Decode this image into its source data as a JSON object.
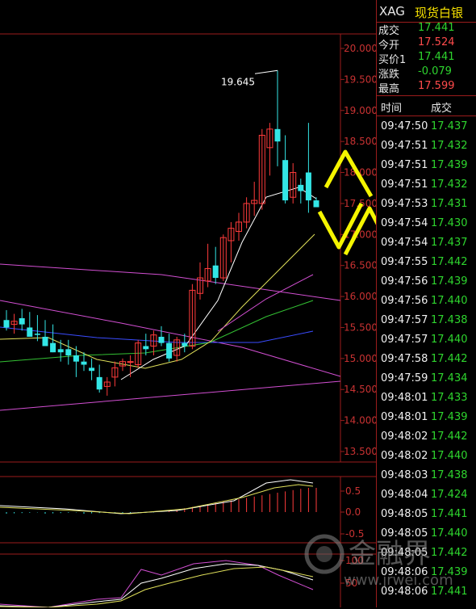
{
  "instrument": {
    "code": "XAG",
    "name": "现货白银"
  },
  "quote": [
    {
      "label": "成交",
      "value": "17.441",
      "color": "#2ed52e"
    },
    {
      "label": "今开",
      "value": "17.524",
      "color": "#ff4b4b"
    },
    {
      "label": "买价1",
      "value": "17.441",
      "color": "#2ed52e"
    },
    {
      "label": "涨跌",
      "value": "-0.079",
      "color": "#2ed52e"
    },
    {
      "label": "最高",
      "value": "17.599",
      "color": "#ff4b4b"
    }
  ],
  "ticks_header": {
    "time": "时间",
    "price": "成交"
  },
  "ticks": [
    {
      "time": "09:47:50",
      "price": "17.437"
    },
    {
      "time": "09:47:51",
      "price": "17.432"
    },
    {
      "time": "09:47:51",
      "price": "17.439"
    },
    {
      "time": "09:47:51",
      "price": "17.432"
    },
    {
      "time": "09:47:53",
      "price": "17.431"
    },
    {
      "time": "09:47:54",
      "price": "17.430"
    },
    {
      "time": "09:47:54",
      "price": "17.437"
    },
    {
      "time": "09:47:55",
      "price": "17.442"
    },
    {
      "time": "09:47:56",
      "price": "17.439"
    },
    {
      "time": "09:47:56",
      "price": "17.440"
    },
    {
      "time": "09:47:57",
      "price": "17.438"
    },
    {
      "time": "09:47:57",
      "price": "17.440"
    },
    {
      "time": "09:47:58",
      "price": "17.442"
    },
    {
      "time": "09:47:59",
      "price": "17.434"
    },
    {
      "time": "09:48:01",
      "price": "17.433"
    },
    {
      "time": "09:48:01",
      "price": "17.439"
    },
    {
      "time": "09:48:02",
      "price": "17.442"
    },
    {
      "time": "09:48:02",
      "price": "17.440"
    },
    {
      "time": "09:48:03",
      "price": "17.438"
    },
    {
      "time": "09:48:04",
      "price": "17.424"
    },
    {
      "time": "09:48:05",
      "price": "17.441"
    },
    {
      "time": "09:48:05",
      "price": "17.440"
    },
    {
      "time": "09:48:05",
      "price": "17.442"
    },
    {
      "time": "09:48:06",
      "price": "17.439"
    },
    {
      "time": "09:48:06",
      "price": "17.441"
    }
  ],
  "watermark": {
    "text": "金融界",
    "url": "www.jrwei.com"
  },
  "colors": {
    "up": "#ff3b3b",
    "down": "#33e6e6",
    "tick_price": "#2ed52e",
    "axis": "#9b1c1c",
    "axis_text": "#c83232",
    "arrow": "#f5f500"
  },
  "chart_data": {
    "type": "candlestick",
    "y_ticks": [
      "20.000",
      "19.500",
      "19.000",
      "18.500",
      "18.000",
      "17.500",
      "17.000",
      "16.500",
      "16.000",
      "15.500",
      "15.000",
      "14.500",
      "14.000",
      "13.500"
    ],
    "ylim": [
      13.3,
      20.2
    ],
    "max_annotation": "19.645",
    "candles": [
      {
        "o": 15.62,
        "h": 15.78,
        "l": 15.45,
        "c": 15.5
      },
      {
        "o": 15.55,
        "h": 15.72,
        "l": 15.4,
        "c": 15.6
      },
      {
        "o": 15.65,
        "h": 15.8,
        "l": 15.45,
        "c": 15.55
      },
      {
        "o": 15.5,
        "h": 15.75,
        "l": 15.35,
        "c": 15.35
      },
      {
        "o": 15.4,
        "h": 15.7,
        "l": 15.28,
        "c": 15.38
      },
      {
        "o": 15.35,
        "h": 15.62,
        "l": 15.25,
        "c": 15.2
      },
      {
        "o": 15.25,
        "h": 15.55,
        "l": 15.1,
        "c": 15.1
      },
      {
        "o": 15.15,
        "h": 15.3,
        "l": 14.95,
        "c": 15.1
      },
      {
        "o": 15.15,
        "h": 15.3,
        "l": 14.9,
        "c": 15.05
      },
      {
        "o": 15.05,
        "h": 15.2,
        "l": 14.7,
        "c": 14.95
      },
      {
        "o": 14.95,
        "h": 15.1,
        "l": 14.8,
        "c": 14.9
      },
      {
        "o": 14.85,
        "h": 15.0,
        "l": 14.65,
        "c": 14.8
      },
      {
        "o": 14.7,
        "h": 14.9,
        "l": 14.45,
        "c": 14.5
      },
      {
        "o": 14.55,
        "h": 14.7,
        "l": 14.4,
        "c": 14.62
      },
      {
        "o": 14.7,
        "h": 14.95,
        "l": 14.55,
        "c": 14.85
      },
      {
        "o": 14.88,
        "h": 15.0,
        "l": 14.8,
        "c": 14.95
      },
      {
        "o": 14.95,
        "h": 15.05,
        "l": 14.7,
        "c": 14.95
      },
      {
        "o": 14.9,
        "h": 15.3,
        "l": 14.85,
        "c": 15.25
      },
      {
        "o": 15.2,
        "h": 15.4,
        "l": 15.05,
        "c": 15.15
      },
      {
        "o": 15.2,
        "h": 15.45,
        "l": 15.05,
        "c": 15.38
      },
      {
        "o": 15.35,
        "h": 15.52,
        "l": 15.2,
        "c": 15.25
      },
      {
        "o": 15.25,
        "h": 15.4,
        "l": 14.95,
        "c": 15.0
      },
      {
        "o": 15.05,
        "h": 15.35,
        "l": 14.95,
        "c": 15.3
      },
      {
        "o": 15.25,
        "h": 15.4,
        "l": 15.1,
        "c": 15.2
      },
      {
        "o": 15.2,
        "h": 16.2,
        "l": 15.15,
        "c": 16.1
      },
      {
        "o": 16.05,
        "h": 16.55,
        "l": 15.95,
        "c": 16.3
      },
      {
        "o": 16.25,
        "h": 16.85,
        "l": 16.15,
        "c": 16.45
      },
      {
        "o": 16.5,
        "h": 16.8,
        "l": 16.2,
        "c": 16.3
      },
      {
        "o": 16.3,
        "h": 17.0,
        "l": 16.25,
        "c": 16.95
      },
      {
        "o": 16.9,
        "h": 17.2,
        "l": 16.55,
        "c": 17.1
      },
      {
        "o": 17.05,
        "h": 17.35,
        "l": 16.9,
        "c": 17.2
      },
      {
        "o": 17.2,
        "h": 17.6,
        "l": 17.1,
        "c": 17.5
      },
      {
        "o": 17.5,
        "h": 17.85,
        "l": 17.3,
        "c": 17.55
      },
      {
        "o": 17.5,
        "h": 18.7,
        "l": 17.4,
        "c": 18.6
      },
      {
        "o": 18.4,
        "h": 18.8,
        "l": 17.95,
        "c": 18.7
      },
      {
        "o": 18.7,
        "h": 19.645,
        "l": 18.1,
        "c": 18.5
      },
      {
        "o": 18.2,
        "h": 18.6,
        "l": 17.5,
        "c": 17.55
      },
      {
        "o": 17.6,
        "h": 18.15,
        "l": 17.5,
        "c": 18.0
      },
      {
        "o": 17.8,
        "h": 17.9,
        "l": 17.5,
        "c": 17.7
      },
      {
        "o": 18.0,
        "h": 18.8,
        "l": 17.35,
        "c": 17.55
      },
      {
        "o": 17.55,
        "h": 17.6,
        "l": 17.44,
        "c": 17.44
      }
    ],
    "macd_ticks": [
      "0.5",
      "0.0",
      "-0.5"
    ],
    "kdj_ticks": [
      "100",
      "50"
    ]
  }
}
